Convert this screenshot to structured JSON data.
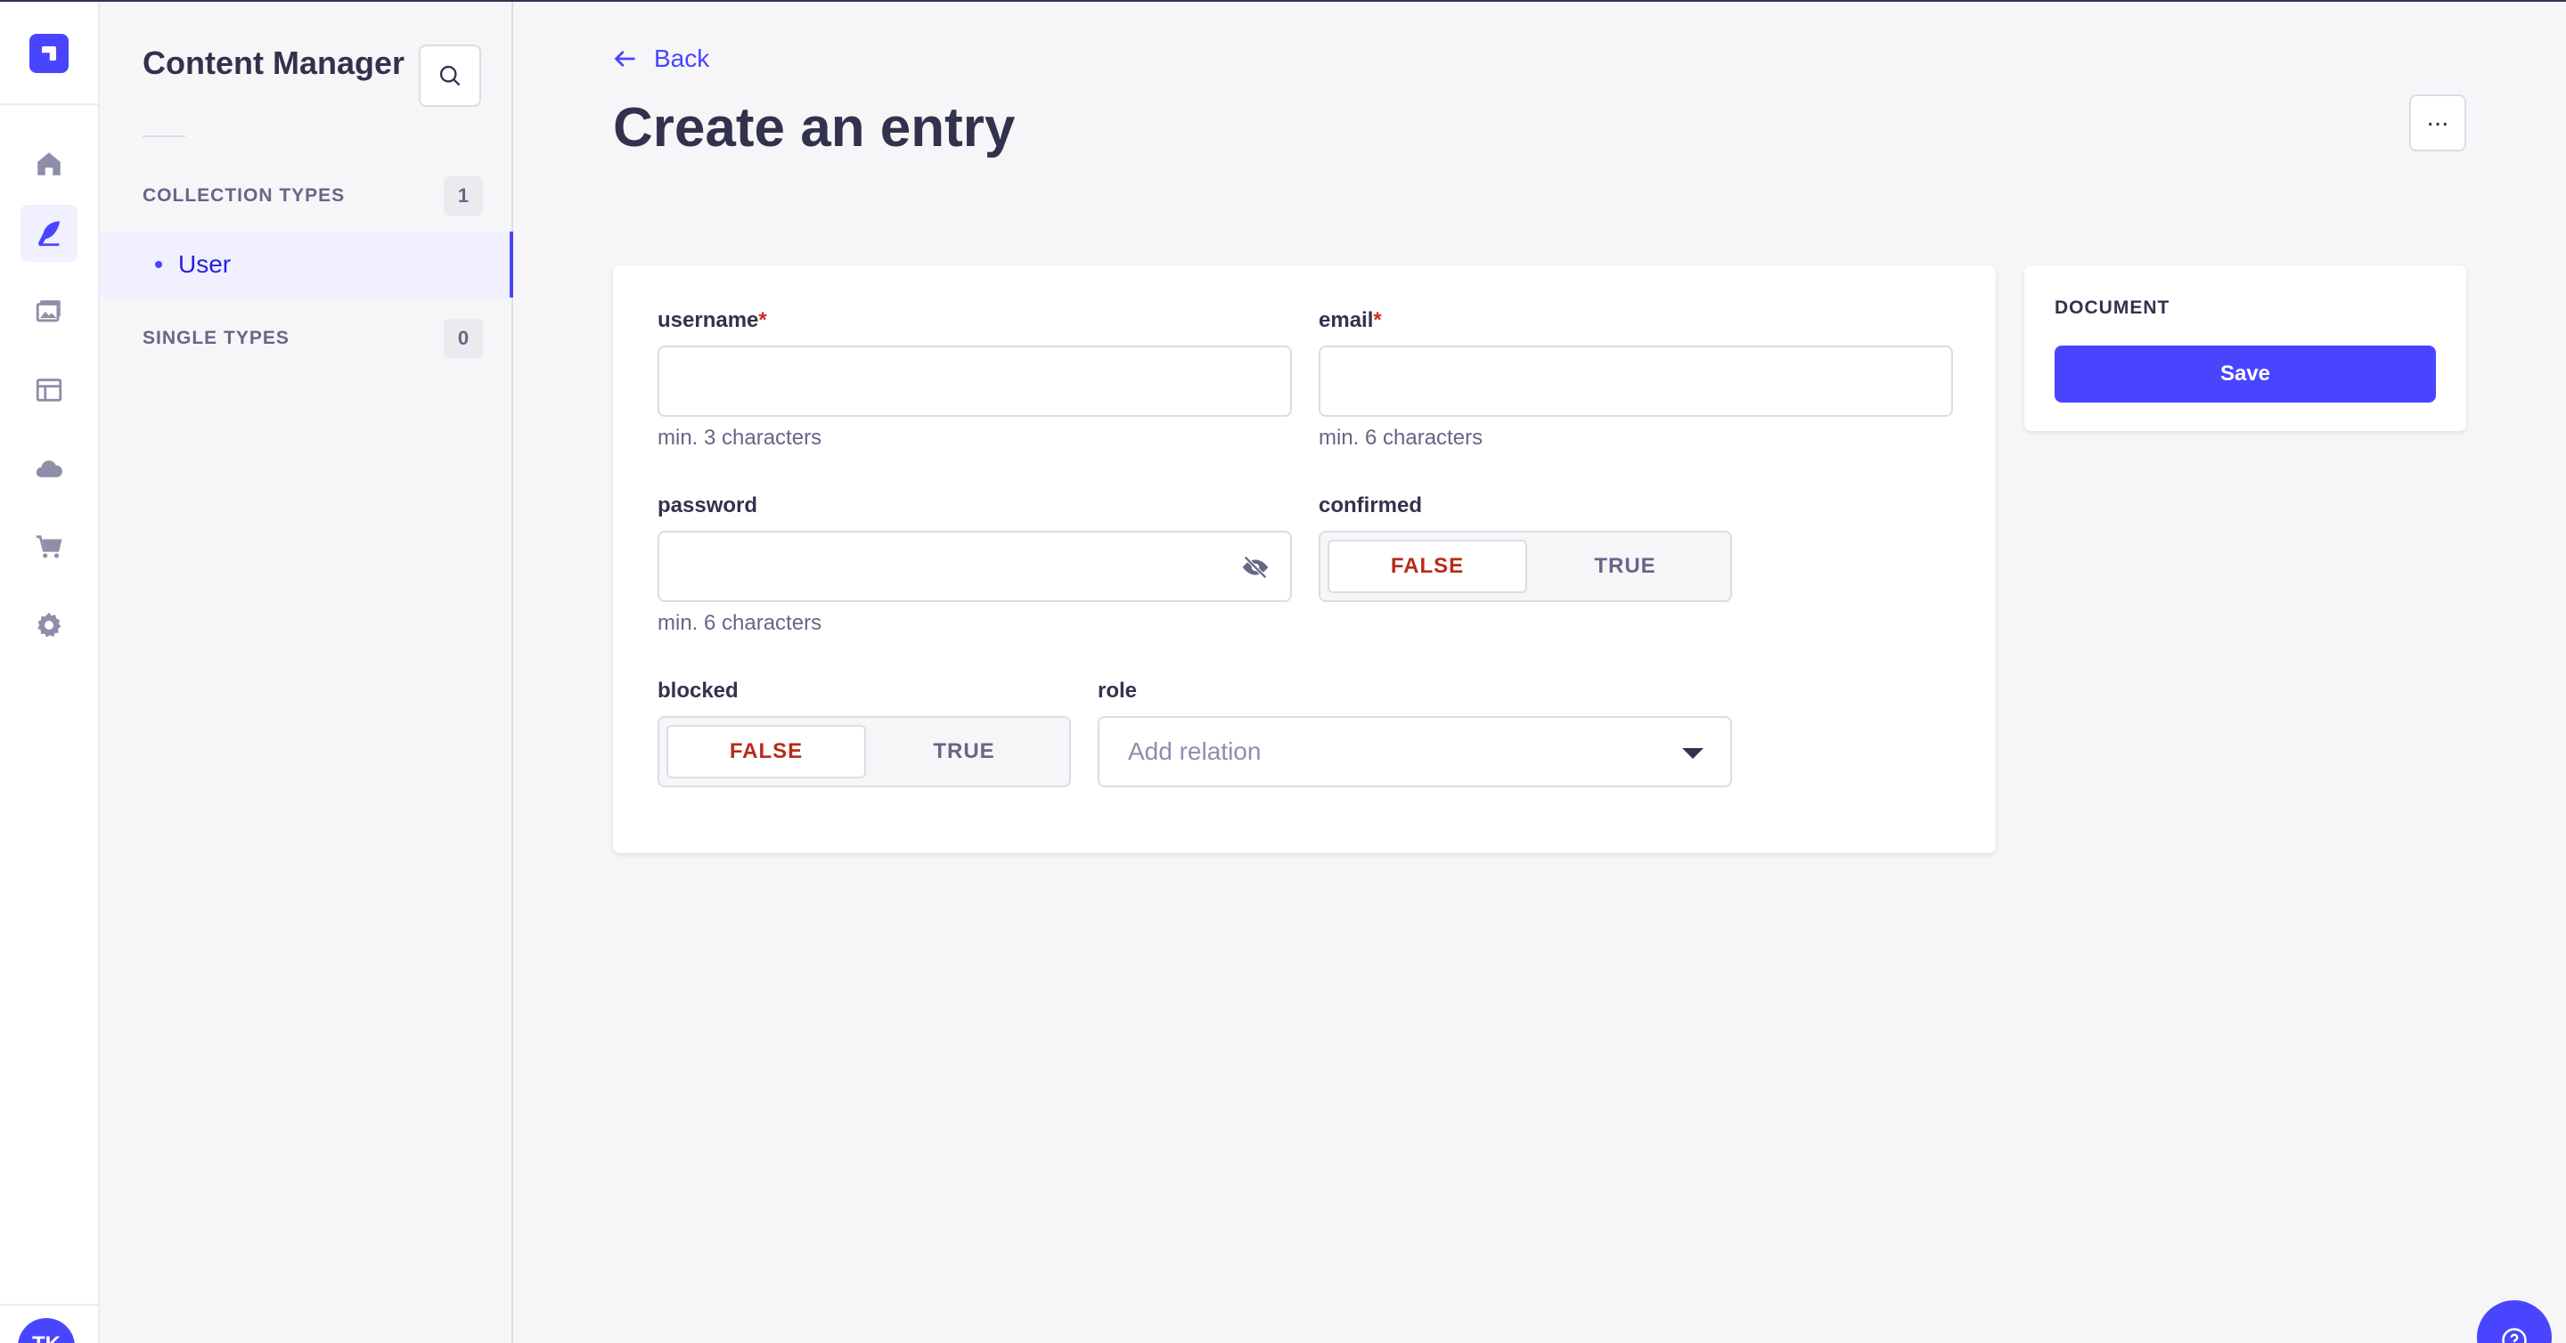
{
  "rail": {
    "items": [
      {
        "icon": "home-icon"
      },
      {
        "icon": "content-manager-icon",
        "active": true
      },
      {
        "icon": "media-library-icon"
      },
      {
        "icon": "layout-icon"
      },
      {
        "icon": "cloud-icon"
      },
      {
        "icon": "cart-icon"
      },
      {
        "icon": "gear-icon"
      }
    ],
    "avatar_initials": "TK"
  },
  "subnav": {
    "title": "Content Manager",
    "collection_types": {
      "label": "COLLECTION TYPES",
      "count": "1",
      "items": [
        "User"
      ]
    },
    "single_types": {
      "label": "SINGLE TYPES",
      "count": "0"
    }
  },
  "header": {
    "back_label": "Back",
    "title": "Create an entry",
    "more_label": "..."
  },
  "form": {
    "username": {
      "label": "username",
      "required": "*",
      "value": "",
      "hint": "min. 3 characters"
    },
    "email": {
      "label": "email",
      "required": "*",
      "value": "",
      "hint": "min. 6 characters"
    },
    "password": {
      "label": "password",
      "value": "",
      "hint": "min. 6 characters"
    },
    "confirmed": {
      "label": "confirmed",
      "options": [
        "FALSE",
        "TRUE"
      ],
      "selected": "FALSE"
    },
    "blocked": {
      "label": "blocked",
      "options": [
        "FALSE",
        "TRUE"
      ],
      "selected": "FALSE"
    },
    "role": {
      "label": "role",
      "placeholder": "Add relation"
    }
  },
  "document_panel": {
    "title": "DOCUMENT",
    "save_label": "Save"
  },
  "colors": {
    "primary": "#4945ff",
    "danger": "#d02b20",
    "text": "#32324d",
    "muted": "#666687",
    "background": "#f6f6f9"
  }
}
